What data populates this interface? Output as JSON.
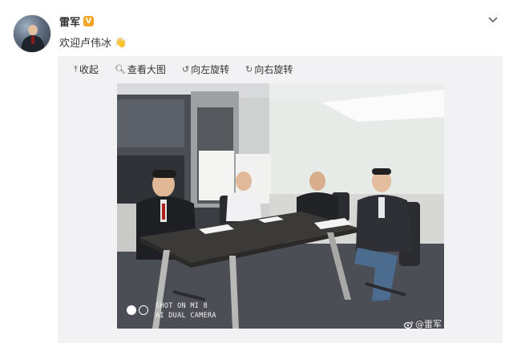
{
  "post": {
    "author": "雷军",
    "verified_mark": "V",
    "text": "欢迎卢伟冰",
    "emoji": "👋"
  },
  "toolbar": {
    "collapse": "收起",
    "view_large": "查看大图",
    "rotate_left": "向左旋转",
    "rotate_right": "向右旋转"
  },
  "photo": {
    "shot_line1": "SHOT ON MI 8",
    "shot_line2": "AI DUAL CAMERA",
    "watermark": "@雷军"
  },
  "colors": {
    "verified": "#f5a623",
    "media_bg": "#f2f2f5"
  }
}
